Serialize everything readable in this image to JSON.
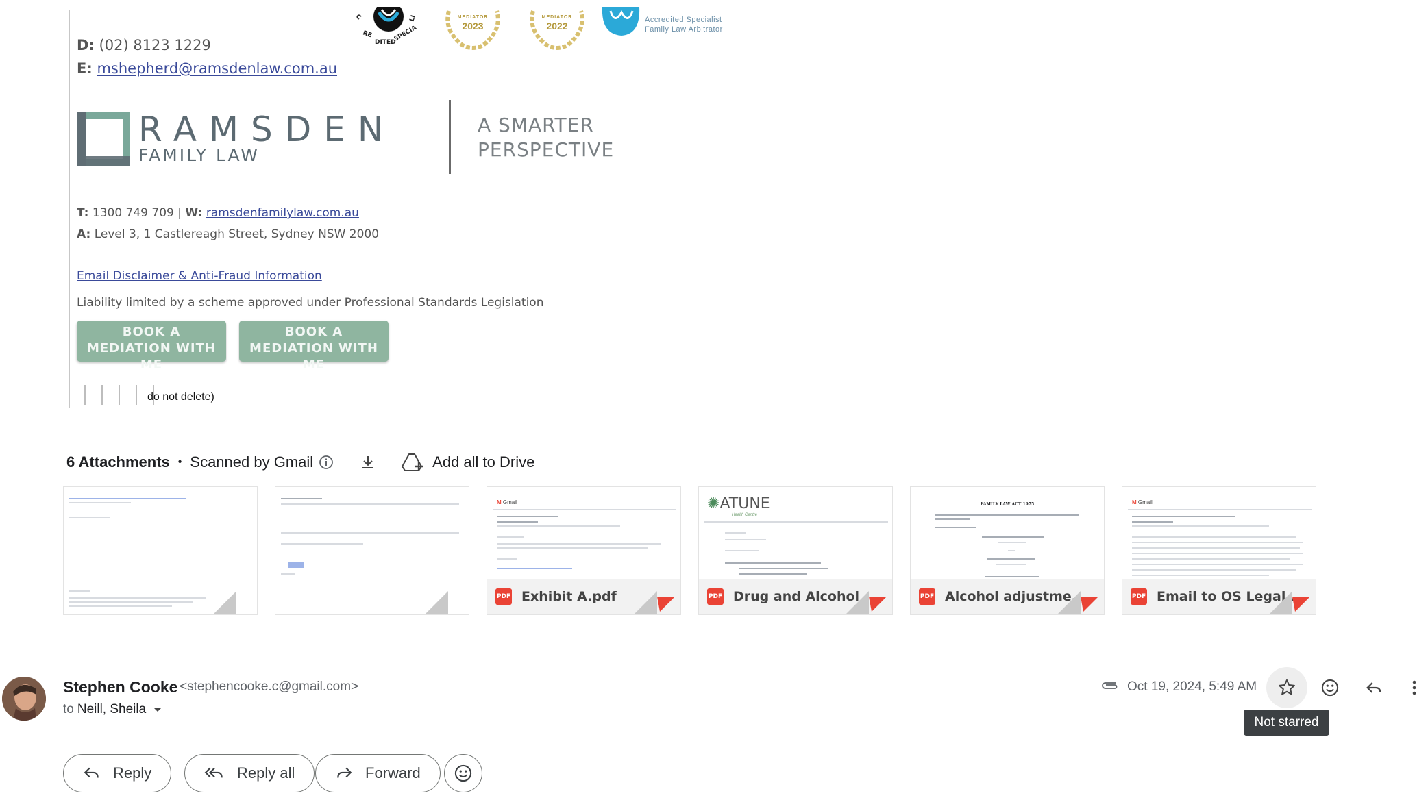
{
  "signature": {
    "badges": {
      "seal_text": "CREDITED SPECIALI",
      "mediator_2023_label": "MEDIATOR",
      "mediator_2023_year": "2023",
      "mediator_2022_label": "MEDIATOR",
      "mediator_2022_year": "2022",
      "aiafl_line1": "Accredited Specialist",
      "aiafl_line2": "Family Law Arbitrator"
    },
    "direct_label": "D:",
    "direct_phone": "(02) 8123 1229",
    "email_label": "E:",
    "email": "mshepherd@ramsdenlaw.com.au",
    "logo_word": "RAMSDEN",
    "logo_sub": "FAMILY LAW",
    "tagline_line1": "A SMARTER",
    "tagline_line2": "PERSPECTIVE",
    "tel_label": "T:",
    "tel": "1300 749 709",
    "sep": "|",
    "web_label": "W:",
    "web": "ramsdenfamilylaw.com.au",
    "addr_label": "A:",
    "address": "Level 3, 1 Castlereagh Street, Sydney NSW 2000",
    "disclaimer_link": "Email Disclaimer & Anti-Fraud Information",
    "liability": "Liability limited by a scheme approved under Professional Standards Legislation",
    "book_buttons": [
      {
        "line1": "BOOK A",
        "line2": "MEDIATION WITH ME"
      },
      {
        "line1": "BOOK A",
        "line2": "MEDIATION WITH ME"
      }
    ],
    "do_not_delete": "do not delete)"
  },
  "attachments": {
    "count_label": "6 Attachments",
    "scanned_label": "Scanned by Gmail",
    "add_drive_label": "Add all to Drive",
    "items": [
      {
        "name": ""
      },
      {
        "name": ""
      },
      {
        "name": "Exhibit A.pdf",
        "badge": "PDF"
      },
      {
        "name": "Drug and Alcohol ...",
        "badge": "PDF"
      },
      {
        "name": "Alcohol adjustme...",
        "badge": "PDF"
      },
      {
        "name": "Email to OS Legal...",
        "badge": "PDF"
      }
    ],
    "preview_texts": {
      "gmail": "Gmail",
      "atune": "ATUNE",
      "atune_sub": "Health Centre",
      "family_law_act": "FAMILY LAW ACT 1975"
    }
  },
  "message": {
    "sender_name": "Stephen Cooke",
    "sender_email": "<stephencooke.c@gmail.com>",
    "to_label": "to",
    "to_names": "Neill, Sheila",
    "date": "Oct 19, 2024, 5:49 AM",
    "tooltip": "Not starred"
  },
  "actions": {
    "reply": "Reply",
    "reply_all": "Reply all",
    "forward": "Forward"
  },
  "colors": {
    "book_button": "#8fb5a0",
    "pdf_red": "#ea4335",
    "tooltip_bg": "#3c4043"
  }
}
